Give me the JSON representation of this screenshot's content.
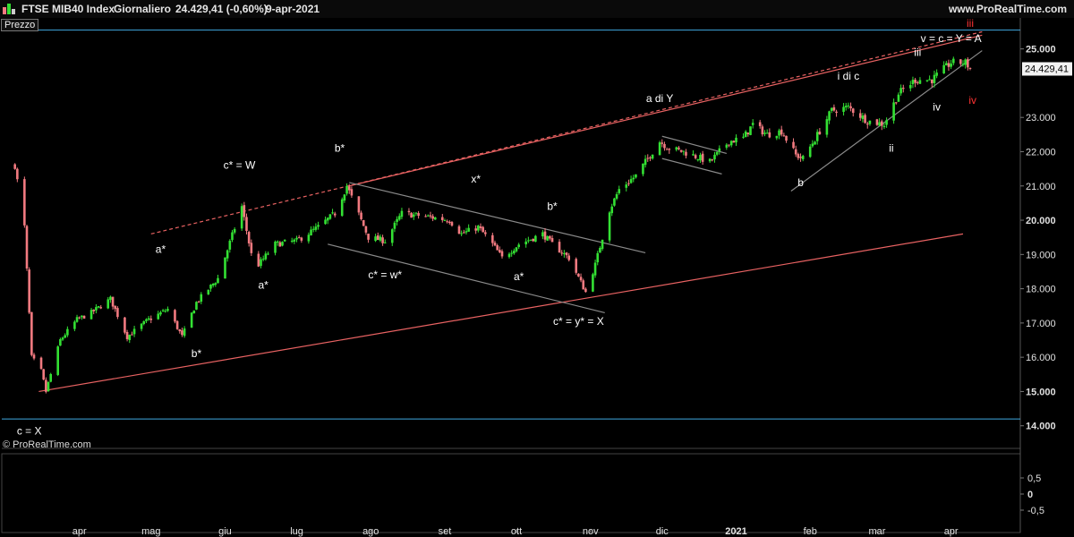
{
  "header": {
    "instrument": "FTSE MIB40 Index",
    "period": "Giornaliero",
    "last": "24.429,41 (-0,60%)",
    "date": "9-apr-2021",
    "website": "www.ProRealTime.com"
  },
  "panel_label": "Prezzo",
  "watermark": "© ProRealTime.com",
  "colors": {
    "up": "#33e033",
    "down": "#f27a80",
    "channel": "#e86262",
    "level": "#3fa8e0",
    "trend": "#8a8a8a"
  },
  "chart_data": {
    "type": "candlestick",
    "title": "FTSE MIB40 Index",
    "period": "Giornaliero",
    "last_price_label": "24.429,41",
    "ylim": [
      13500,
      25900
    ],
    "y_ticks": [
      {
        "v": 14000,
        "label": "14.000",
        "bold": true
      },
      {
        "v": 15000,
        "label": "15.000",
        "bold": true
      },
      {
        "v": 16000,
        "label": "16.000",
        "bold": false
      },
      {
        "v": 17000,
        "label": "17.000",
        "bold": false
      },
      {
        "v": 18000,
        "label": "18.000",
        "bold": false
      },
      {
        "v": 19000,
        "label": "19.000",
        "bold": false
      },
      {
        "v": 20000,
        "label": "20.000",
        "bold": true
      },
      {
        "v": 21000,
        "label": "21.000",
        "bold": false
      },
      {
        "v": 22000,
        "label": "22.000",
        "bold": false
      },
      {
        "v": 23000,
        "label": "23.000",
        "bold": false
      },
      {
        "v": 25000,
        "label": "25.000",
        "bold": true
      }
    ],
    "x_labels": [
      {
        "label": "apr",
        "date": "2020-04-01",
        "bold": false
      },
      {
        "label": "mag",
        "date": "2020-05-01",
        "bold": false
      },
      {
        "label": "giu",
        "date": "2020-06-01",
        "bold": false
      },
      {
        "label": "lug",
        "date": "2020-07-01",
        "bold": false
      },
      {
        "label": "ago",
        "date": "2020-08-01",
        "bold": false
      },
      {
        "label": "set",
        "date": "2020-09-01",
        "bold": false
      },
      {
        "label": "ott",
        "date": "2020-10-01",
        "bold": false
      },
      {
        "label": "nov",
        "date": "2020-11-01",
        "bold": false
      },
      {
        "label": "dic",
        "date": "2020-12-01",
        "bold": false
      },
      {
        "label": "2021",
        "date": "2021-01-01",
        "bold": true
      },
      {
        "label": "feb",
        "date": "2021-02-01",
        "bold": false
      },
      {
        "label": "mar",
        "date": "2021-03-01",
        "bold": false
      },
      {
        "label": "apr",
        "date": "2021-04-01",
        "bold": false
      }
    ],
    "close_path": [
      [
        "2020-03-05",
        21600
      ],
      [
        "2020-03-09",
        19800
      ],
      [
        "2020-03-12",
        16000
      ],
      [
        "2020-03-16",
        15600
      ],
      [
        "2020-03-18",
        15000
      ],
      [
        "2020-03-24",
        16500
      ],
      [
        "2020-03-31",
        17100
      ],
      [
        "2020-04-06",
        17300
      ],
      [
        "2020-04-14",
        17700
      ],
      [
        "2020-04-21",
        16600
      ],
      [
        "2020-04-30",
        17100
      ],
      [
        "2020-05-08",
        17400
      ],
      [
        "2020-05-14",
        16600
      ],
      [
        "2020-05-20",
        17600
      ],
      [
        "2020-05-29",
        18300
      ],
      [
        "2020-06-08",
        20400
      ],
      [
        "2020-06-12",
        19000
      ],
      [
        "2020-06-15",
        18700
      ],
      [
        "2020-06-22",
        19300
      ],
      [
        "2020-07-01",
        19400
      ],
      [
        "2020-07-10",
        19800
      ],
      [
        "2020-07-17",
        20200
      ],
      [
        "2020-07-22",
        21000
      ],
      [
        "2020-07-31",
        19500
      ],
      [
        "2020-08-07",
        19400
      ],
      [
        "2020-08-14",
        20200
      ],
      [
        "2020-08-25",
        20100
      ],
      [
        "2020-09-03",
        20000
      ],
      [
        "2020-09-08",
        19600
      ],
      [
        "2020-09-15",
        19800
      ],
      [
        "2020-09-21",
        19300
      ],
      [
        "2020-09-25",
        18900
      ],
      [
        "2020-10-02",
        19300
      ],
      [
        "2020-10-12",
        19600
      ],
      [
        "2020-10-16",
        19300
      ],
      [
        "2020-10-23",
        18900
      ],
      [
        "2020-10-30",
        17900
      ],
      [
        "2020-11-03",
        18700
      ],
      [
        "2020-11-09",
        20300
      ],
      [
        "2020-11-13",
        20900
      ],
      [
        "2020-11-20",
        21300
      ],
      [
        "2020-11-30",
        22300
      ],
      [
        "2020-12-04",
        22100
      ],
      [
        "2020-12-10",
        22000
      ],
      [
        "2020-12-21",
        21700
      ],
      [
        "2020-12-29",
        22300
      ],
      [
        "2021-01-04",
        22400
      ],
      [
        "2021-01-08",
        22800
      ],
      [
        "2021-01-14",
        22500
      ],
      [
        "2021-01-20",
        22600
      ],
      [
        "2021-01-26",
        21900
      ],
      [
        "2021-01-29",
        21800
      ],
      [
        "2021-02-05",
        22600
      ],
      [
        "2021-02-10",
        23200
      ],
      [
        "2021-02-17",
        23300
      ],
      [
        "2021-02-25",
        22900
      ],
      [
        "2021-03-04",
        22800
      ],
      [
        "2021-03-10",
        23700
      ],
      [
        "2021-03-17",
        24100
      ],
      [
        "2021-03-24",
        24100
      ],
      [
        "2021-04-01",
        24600
      ],
      [
        "2021-04-07",
        24600
      ],
      [
        "2021-04-09",
        24429
      ]
    ],
    "horizontal_levels": [
      14200,
      25550
    ],
    "channel_lines": [
      {
        "kind": "solid",
        "from": [
          "2020-03-15",
          15000
        ],
        "to": [
          "2021-04-06",
          19600
        ]
      },
      {
        "kind": "solid",
        "from": [
          "2020-07-23",
          21000
        ],
        "to": [
          "2021-04-14",
          25400
        ]
      },
      {
        "kind": "dashed",
        "from": [
          "2020-05-01",
          19600
        ],
        "to": [
          "2021-04-14",
          25500
        ]
      }
    ],
    "trend_lines": [
      {
        "from": [
          "2020-07-23",
          21100
        ],
        "to": [
          "2020-11-24",
          19050
        ]
      },
      {
        "from": [
          "2020-07-14",
          19300
        ],
        "to": [
          "2020-11-07",
          17300
        ]
      },
      {
        "from": [
          "2020-12-01",
          22450
        ],
        "to": [
          "2020-12-28",
          21950
        ]
      },
      {
        "from": [
          "2020-12-01",
          21800
        ],
        "to": [
          "2020-12-26",
          21350
        ]
      },
      {
        "from": [
          "2021-01-24",
          20850
        ],
        "to": [
          "2021-04-14",
          24950
        ]
      }
    ],
    "annotations": [
      {
        "text": "a*",
        "date": "2020-05-05",
        "price": 19050,
        "color": "#ffffff"
      },
      {
        "text": "b*",
        "date": "2020-05-20",
        "price": 16000,
        "color": "#ffffff"
      },
      {
        "text": "c* = W",
        "date": "2020-06-07",
        "price": 21500,
        "color": "#ffffff"
      },
      {
        "text": "a*",
        "date": "2020-06-17",
        "price": 18000,
        "color": "#ffffff"
      },
      {
        "text": "b*",
        "date": "2020-07-19",
        "price": 22000,
        "color": "#ffffff"
      },
      {
        "text": "c* = w*",
        "date": "2020-08-07",
        "price": 18300,
        "color": "#ffffff"
      },
      {
        "text": "x*",
        "date": "2020-09-14",
        "price": 21100,
        "color": "#ffffff"
      },
      {
        "text": "a*",
        "date": "2020-10-02",
        "price": 18250,
        "color": "#ffffff"
      },
      {
        "text": "b*",
        "date": "2020-10-16",
        "price": 20300,
        "color": "#ffffff"
      },
      {
        "text": "c* = y* = X",
        "date": "2020-10-27",
        "price": 16950,
        "color": "#ffffff"
      },
      {
        "text": "a di Y",
        "date": "2020-11-30",
        "price": 23450,
        "color": "#ffffff"
      },
      {
        "text": "b",
        "date": "2021-01-28",
        "price": 21000,
        "color": "#ffffff"
      },
      {
        "text": "i di c",
        "date": "2021-02-17",
        "price": 24100,
        "color": "#ffffff"
      },
      {
        "text": "ii",
        "date": "2021-03-07",
        "price": 22000,
        "color": "#ffffff"
      },
      {
        "text": "iii",
        "date": "2021-03-18",
        "price": 24800,
        "color": "#ffffff"
      },
      {
        "text": "iv",
        "date": "2021-03-26",
        "price": 23200,
        "color": "#ffffff"
      },
      {
        "text": "v = c = Y = A",
        "date": "2021-04-01",
        "price": 25200,
        "color": "#ffffff"
      },
      {
        "text": "iii",
        "date": "2021-04-09",
        "price": 25650,
        "color": "#ff3333"
      },
      {
        "text": "iv",
        "date": "2021-04-10",
        "price": 23400,
        "color": "#ff3333"
      },
      {
        "text": "c = X",
        "date": "2020-03-11",
        "price": 13750,
        "color": "#ffffff"
      }
    ],
    "oscillator": {
      "y_ticks": [
        {
          "v": 0.5,
          "label": "0,5"
        },
        {
          "v": 0,
          "label": "0",
          "bold": true
        },
        {
          "v": -0.5,
          "label": "-0,5"
        }
      ]
    }
  }
}
